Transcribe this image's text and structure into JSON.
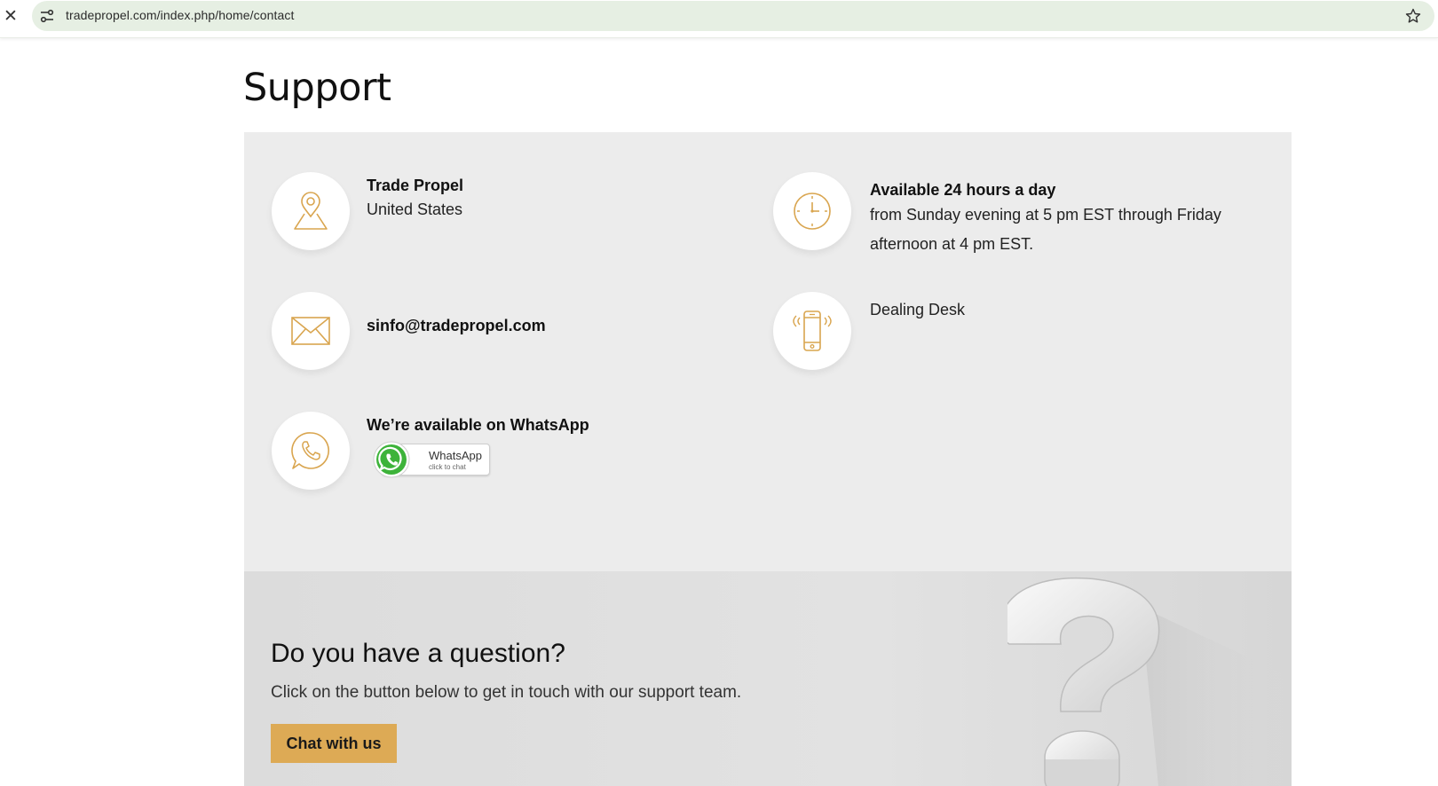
{
  "browser": {
    "url": "tradepropel.com/index.php/home/contact"
  },
  "page": {
    "title": "Support"
  },
  "contact": {
    "company_name": "Trade Propel",
    "company_location": "United States",
    "email": "sinfo@tradepropel.com",
    "whatsapp_heading": "We’re available on WhatsApp",
    "whatsapp_badge_label": "WhatsApp",
    "whatsapp_badge_sub": "click to chat",
    "hours_title": "Available 24 hours a day",
    "hours_text": "from Sunday evening at 5 pm EST through Friday afternoon at 4 pm EST.",
    "phone_label": "Dealing Desk"
  },
  "question": {
    "title": "Do you have a question?",
    "text": "Click on the button below to get in touch with our support team.",
    "button_label": "Chat with us"
  },
  "colors": {
    "accent_gold": "#ddaa55",
    "icon_stroke": "#d9a54f",
    "panel_bg": "#ececec",
    "whatsapp_green": "#25d366"
  }
}
